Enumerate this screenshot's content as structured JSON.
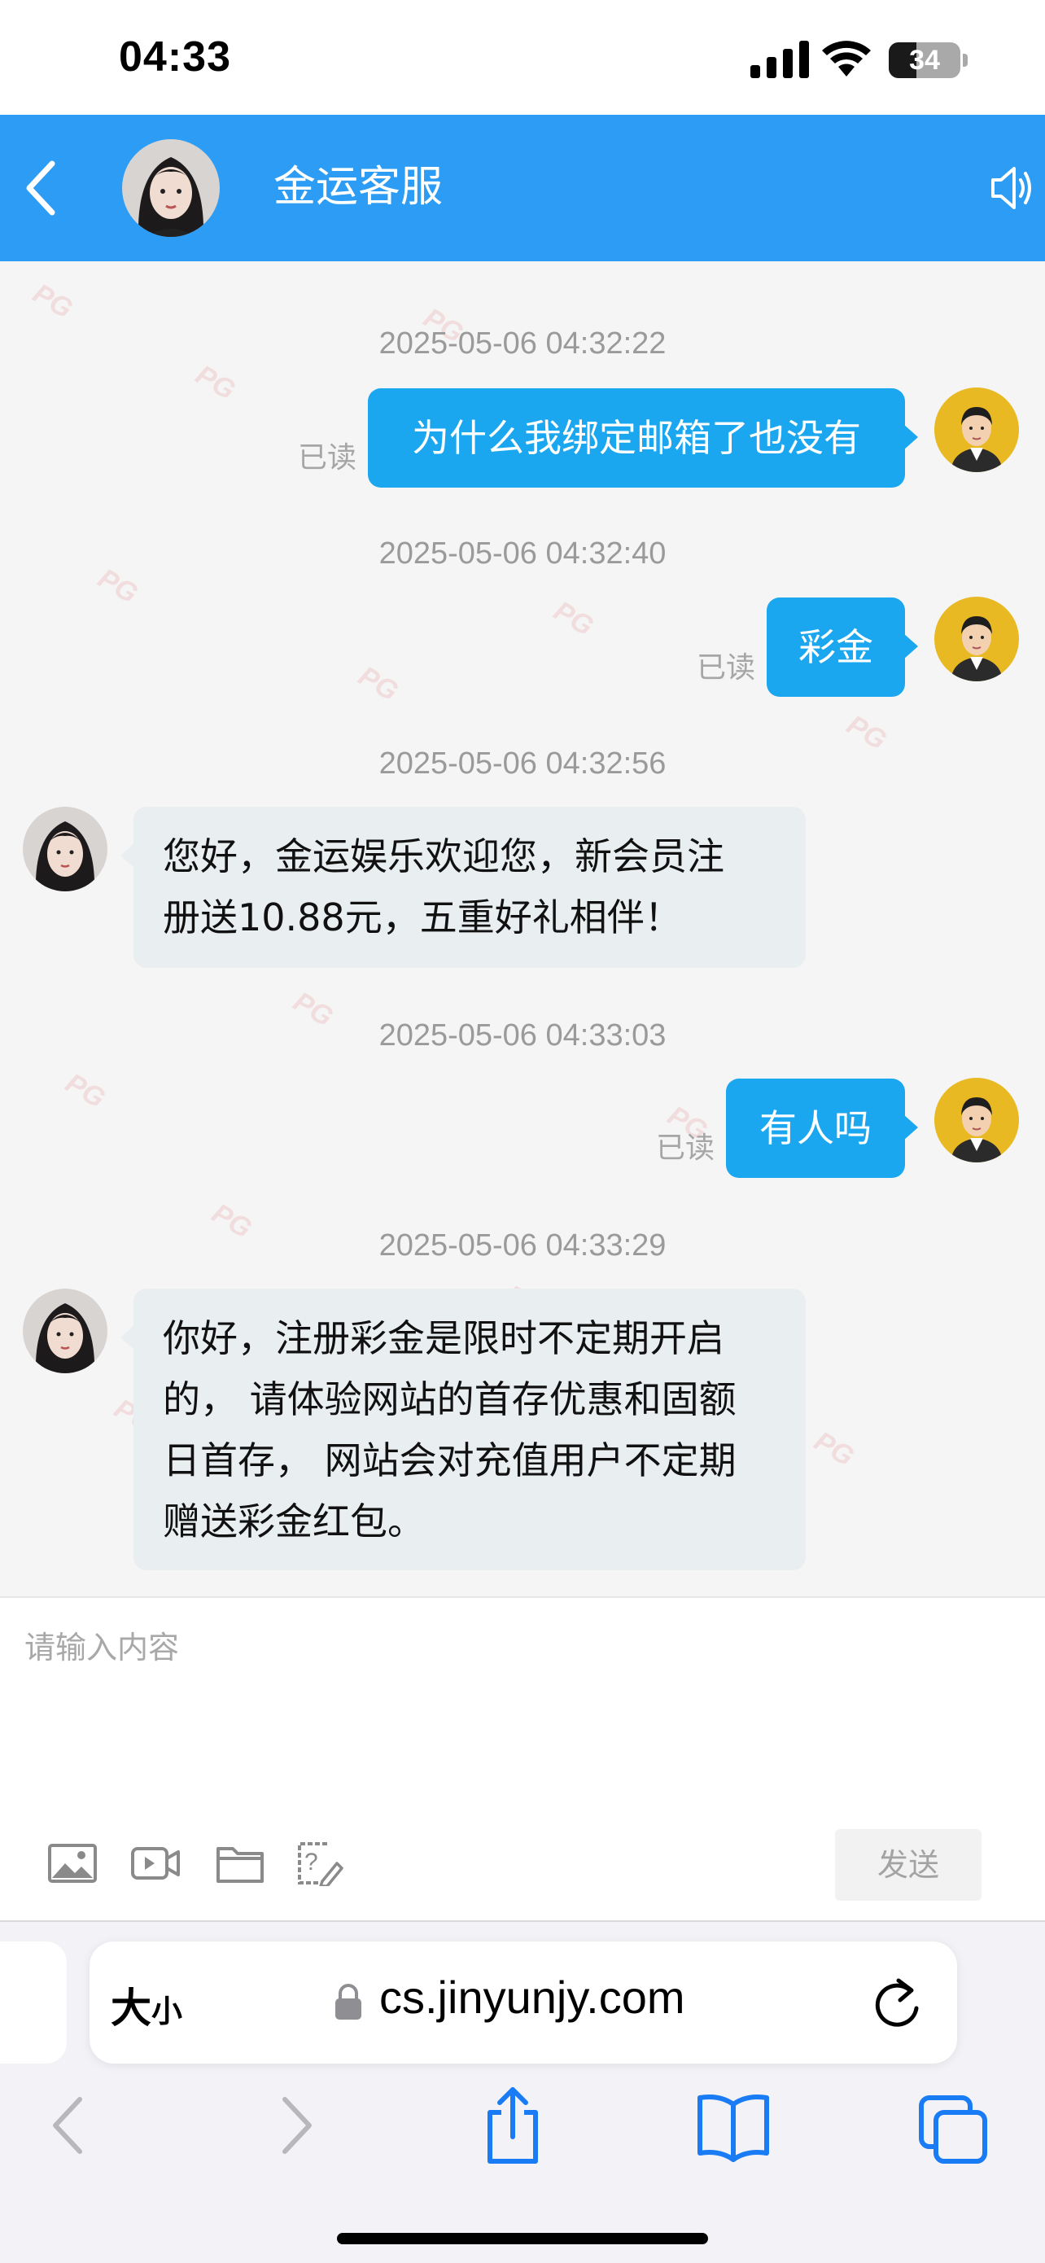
{
  "status_bar": {
    "time": "04:33",
    "battery": "34"
  },
  "header": {
    "title": "金运客服"
  },
  "watermark": "PG",
  "messages": [
    {
      "timestamp": "2025-05-06 04:32:22",
      "side": "right",
      "text": "为什么我绑定邮箱了也没有",
      "status": "已读"
    },
    {
      "timestamp": "2025-05-06 04:32:40",
      "side": "right",
      "text": "彩金",
      "status": "已读"
    },
    {
      "timestamp": "2025-05-06 04:32:56",
      "side": "left",
      "lines": [
        "您好，金运娱乐欢迎您，新会员注",
        "册送10.88元，五重好礼相伴！"
      ]
    },
    {
      "timestamp": "2025-05-06 04:33:03",
      "side": "right",
      "text": "有人吗",
      "status": "已读"
    },
    {
      "timestamp": "2025-05-06 04:33:29",
      "side": "left",
      "lines": [
        "你好，注册彩金是限时不定期开启",
        "的， 请体验网站的首存优惠和固额",
        "日首存， 网站会对充值用户不定期",
        "赠送彩金红包。"
      ]
    }
  ],
  "composer": {
    "placeholder": "请输入内容",
    "send_label": "发送",
    "tools": [
      "image-icon",
      "video-icon",
      "folder-icon",
      "help-edit-icon"
    ]
  },
  "browser": {
    "text_size_label": "大",
    "text_size_small": "小",
    "url": "cs.jinyunjy.com"
  },
  "colors": {
    "header": "#2d9cf5",
    "bubble_out": "#1ba7f0",
    "bubble_in": "#e9eef0"
  }
}
